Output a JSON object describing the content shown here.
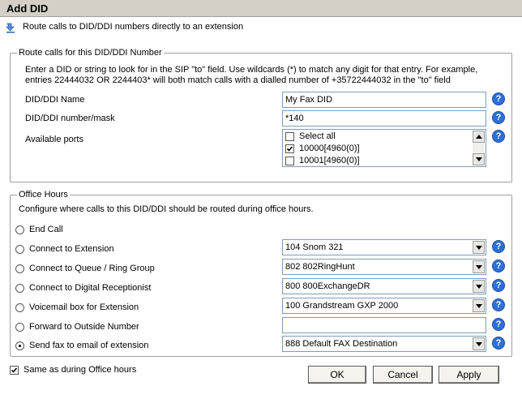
{
  "window": {
    "title": "Add DID"
  },
  "subtitle": "Route calls to DID/DDI numbers directly to an extension",
  "route_section": {
    "legend": "Route calls for this DID/DDI Number",
    "description": "Enter a DID or string to look for in the SIP \"to\" field. Use wildcards (*) to match any digit for that entry. For example, entries 22444032 OR 2244403* will both match calls with a dialled number of +35722444032 in the \"to\" field",
    "name_label": "DID/DDI Name",
    "name_value": "My Fax DID",
    "mask_label": "DID/DDI number/mask",
    "mask_value": "*140",
    "ports_label": "Available ports",
    "ports": [
      {
        "label": "Select all",
        "checked": false
      },
      {
        "label": "10000[4960(0)]",
        "checked": true
      },
      {
        "label": "10001[4960(0)]",
        "checked": false
      }
    ]
  },
  "office_hours": {
    "legend": "Office Hours",
    "description": "Configure where calls to this DID/DDI should be routed during office hours.",
    "options": [
      {
        "label": "End Call",
        "selected": false,
        "control": "none",
        "value": ""
      },
      {
        "label": "Connect to Extension",
        "selected": false,
        "control": "combo",
        "value": "104 Snom 321"
      },
      {
        "label": "Connect to Queue / Ring Group",
        "selected": false,
        "control": "combo",
        "value": "802 802RingHunt"
      },
      {
        "label": "Connect to Digital Receptionist",
        "selected": false,
        "control": "combo",
        "value": "800 800ExchangeDR"
      },
      {
        "label": "Voicemail box for Extension",
        "selected": false,
        "control": "combo",
        "value": "100 Grandstream GXP 2000"
      },
      {
        "label": "Forward to Outside Number",
        "selected": false,
        "control": "text",
        "value": ""
      },
      {
        "label": "Send fax to email of extension",
        "selected": true,
        "control": "combo",
        "value": "888 Default FAX Destination"
      }
    ]
  },
  "same_as_office_hours": {
    "label": "Same as during Office hours",
    "checked": true
  },
  "buttons": {
    "ok": "OK",
    "cancel": "Cancel",
    "apply": "Apply"
  },
  "help_glyph": "?",
  "colors": {
    "titlebar": "#d4d0c8",
    "help_icon": "#2f6fd6",
    "field_border": "#7f9db9"
  }
}
